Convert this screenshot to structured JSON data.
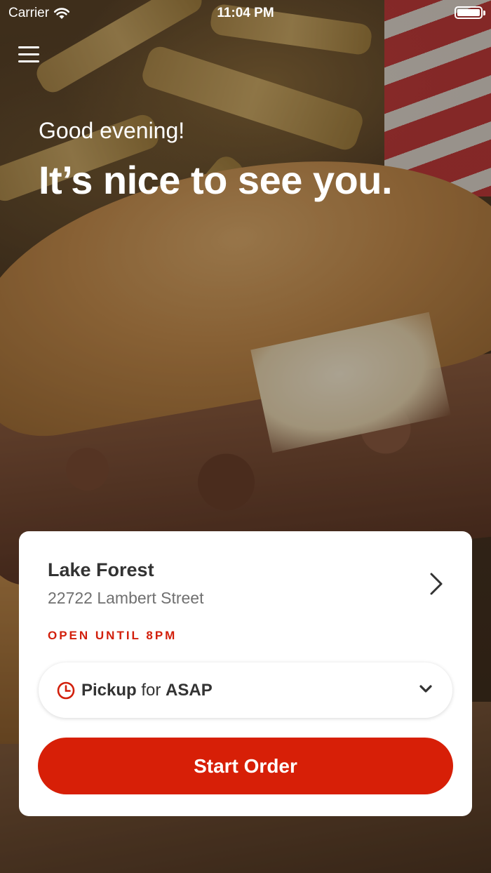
{
  "status_bar": {
    "carrier": "Carrier",
    "time": "11:04 PM",
    "icons": [
      "wifi-icon",
      "battery-icon"
    ]
  },
  "header": {
    "menu_icon": "hamburger-menu-icon",
    "greeting": "Good evening!",
    "headline": "It’s nice to see you."
  },
  "store_card": {
    "name": "Lake Forest",
    "address": "22722 Lambert Street",
    "status": "OPEN UNTIL 8PM",
    "pickup": {
      "mode": "Pickup",
      "connector": " for ",
      "time": "ASAP"
    },
    "start_order_label": "Start Order"
  },
  "colors": {
    "brand_red": "#d71f07",
    "status_red": "#d21f0b",
    "card_bg": "#ffffff",
    "text_dark": "#333333",
    "text_muted": "#707070"
  }
}
